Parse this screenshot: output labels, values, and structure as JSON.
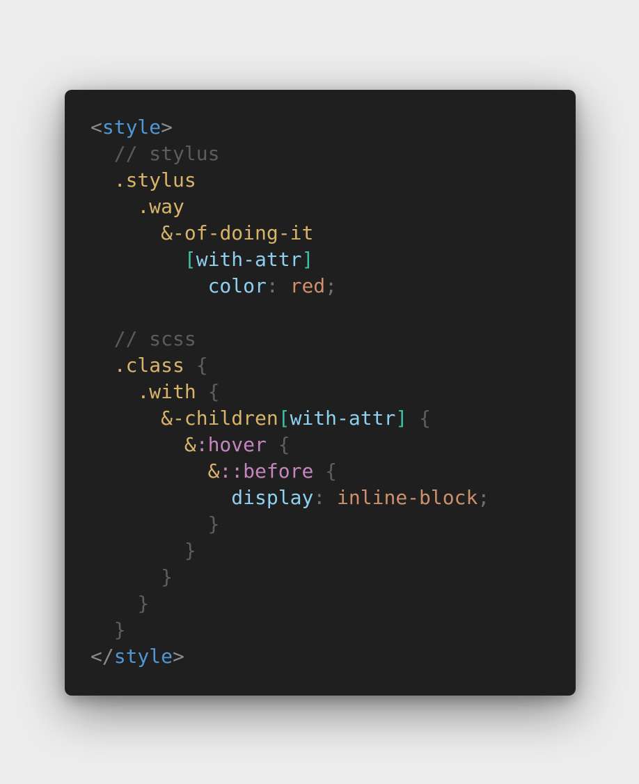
{
  "code": {
    "lines": [
      [
        {
          "t": "<",
          "c": "tagpunct"
        },
        {
          "t": "style",
          "c": "tagname"
        },
        {
          "t": ">",
          "c": "tagpunct"
        }
      ],
      [
        {
          "t": "  ",
          "c": "ws"
        },
        {
          "t": "// stylus",
          "c": "comment"
        }
      ],
      [
        {
          "t": "  ",
          "c": "ws"
        },
        {
          "t": ".stylus",
          "c": "selector"
        }
      ],
      [
        {
          "t": "    ",
          "c": "ws"
        },
        {
          "t": ".way",
          "c": "selector"
        }
      ],
      [
        {
          "t": "      ",
          "c": "ws"
        },
        {
          "t": "&-of-doing-it",
          "c": "selector"
        }
      ],
      [
        {
          "t": "        ",
          "c": "ws"
        },
        {
          "t": "[",
          "c": "bracket"
        },
        {
          "t": "with-attr",
          "c": "attr"
        },
        {
          "t": "]",
          "c": "bracket"
        }
      ],
      [
        {
          "t": "          ",
          "c": "ws"
        },
        {
          "t": "color",
          "c": "prop"
        },
        {
          "t": ":",
          "c": "punct"
        },
        {
          "t": " ",
          "c": "ws"
        },
        {
          "t": "red",
          "c": "value"
        },
        {
          "t": ";",
          "c": "punct"
        }
      ],
      [],
      [
        {
          "t": "  ",
          "c": "ws"
        },
        {
          "t": "// scss",
          "c": "comment"
        }
      ],
      [
        {
          "t": "  ",
          "c": "ws"
        },
        {
          "t": ".class",
          "c": "selector"
        },
        {
          "t": " ",
          "c": "ws"
        },
        {
          "t": "{",
          "c": "brace"
        }
      ],
      [
        {
          "t": "    ",
          "c": "ws"
        },
        {
          "t": ".with",
          "c": "selector"
        },
        {
          "t": " ",
          "c": "ws"
        },
        {
          "t": "{",
          "c": "brace"
        }
      ],
      [
        {
          "t": "      ",
          "c": "ws"
        },
        {
          "t": "&-children",
          "c": "selector"
        },
        {
          "t": "[",
          "c": "bracket"
        },
        {
          "t": "with-attr",
          "c": "attr"
        },
        {
          "t": "]",
          "c": "bracket"
        },
        {
          "t": " ",
          "c": "ws"
        },
        {
          "t": "{",
          "c": "brace"
        }
      ],
      [
        {
          "t": "        ",
          "c": "ws"
        },
        {
          "t": "&",
          "c": "amp"
        },
        {
          "t": ":hover",
          "c": "pseudo"
        },
        {
          "t": " ",
          "c": "ws"
        },
        {
          "t": "{",
          "c": "brace"
        }
      ],
      [
        {
          "t": "          ",
          "c": "ws"
        },
        {
          "t": "&",
          "c": "amp"
        },
        {
          "t": "::before",
          "c": "pseudo"
        },
        {
          "t": " ",
          "c": "ws"
        },
        {
          "t": "{",
          "c": "brace"
        }
      ],
      [
        {
          "t": "            ",
          "c": "ws"
        },
        {
          "t": "display",
          "c": "prop"
        },
        {
          "t": ":",
          "c": "punct"
        },
        {
          "t": " ",
          "c": "ws"
        },
        {
          "t": "inline-block",
          "c": "value"
        },
        {
          "t": ";",
          "c": "punct"
        }
      ],
      [
        {
          "t": "          ",
          "c": "ws"
        },
        {
          "t": "}",
          "c": "brace"
        }
      ],
      [
        {
          "t": "        ",
          "c": "ws"
        },
        {
          "t": "}",
          "c": "brace"
        }
      ],
      [
        {
          "t": "      ",
          "c": "ws"
        },
        {
          "t": "}",
          "c": "brace"
        }
      ],
      [
        {
          "t": "    ",
          "c": "ws"
        },
        {
          "t": "}",
          "c": "brace"
        }
      ],
      [
        {
          "t": "  ",
          "c": "ws"
        },
        {
          "t": "}",
          "c": "brace"
        }
      ],
      [
        {
          "t": "</",
          "c": "tagpunct"
        },
        {
          "t": "style",
          "c": "tagname"
        },
        {
          "t": ">",
          "c": "tagpunct"
        }
      ]
    ]
  }
}
